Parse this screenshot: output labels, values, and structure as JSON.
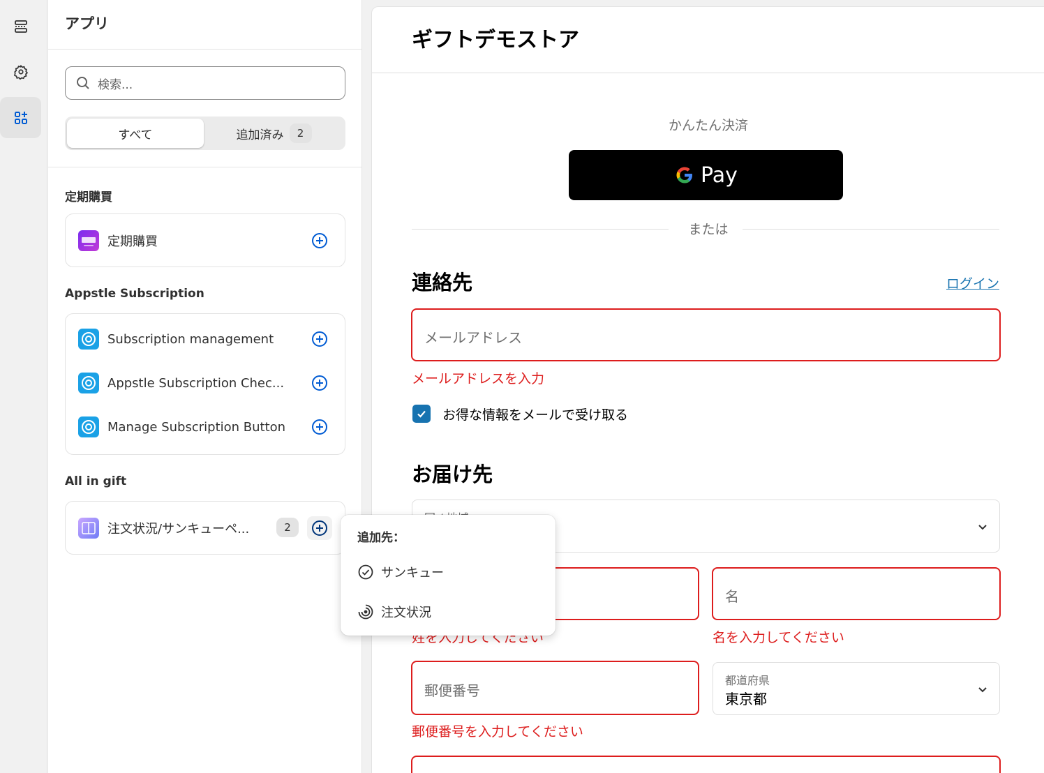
{
  "sidebar": {
    "title": "アプリ",
    "search_placeholder": "検索...",
    "tabs": {
      "all": "すべて",
      "added": "追加済み",
      "added_count": "2"
    },
    "groups": [
      {
        "title": "定期購買",
        "apps": [
          {
            "label": "定期購買",
            "icon": "subscription-app-icon"
          }
        ]
      },
      {
        "title": "Appstle Subscription",
        "apps": [
          {
            "label": "Subscription management",
            "icon": "appstle-icon"
          },
          {
            "label": "Appstle Subscription Chec...",
            "icon": "appstle-icon"
          },
          {
            "label": "Manage Subscription Button",
            "icon": "appstle-icon"
          }
        ]
      },
      {
        "title": "All in gift",
        "apps": [
          {
            "label": "注文状況/サンキューペ...",
            "icon": "all-in-gift-icon",
            "count": "2"
          }
        ]
      }
    ]
  },
  "popover": {
    "title": "追加先：",
    "items": [
      {
        "label": "サンキュー",
        "icon": "check-circle-icon"
      },
      {
        "label": "注文状況",
        "icon": "order-status-icon"
      }
    ]
  },
  "store": {
    "name": "ギフトデモストア",
    "express_label": "かんたん決済",
    "gpay_label": "Pay",
    "or_label": "または",
    "contact": {
      "heading": "連絡先",
      "login_link": "ログイン",
      "email_placeholder": "メールアドレス",
      "email_error": "メールアドレスを入力",
      "newsletter_label": "お得な情報をメールで受け取る",
      "newsletter_checked": true
    },
    "delivery": {
      "heading": "お届け先",
      "country_label": "国 / 地域",
      "first_name_placeholder": "名",
      "last_name_error": "姓を入力してください",
      "first_name_error": "名を入力してください",
      "postal_placeholder": "郵便番号",
      "postal_error": "郵便番号を入力してください",
      "prefecture_label": "都道府県",
      "prefecture_value": "東京都"
    }
  },
  "colors": {
    "error": "#dd1d1d",
    "link": "#1773b0",
    "accent": "#005bd3"
  }
}
